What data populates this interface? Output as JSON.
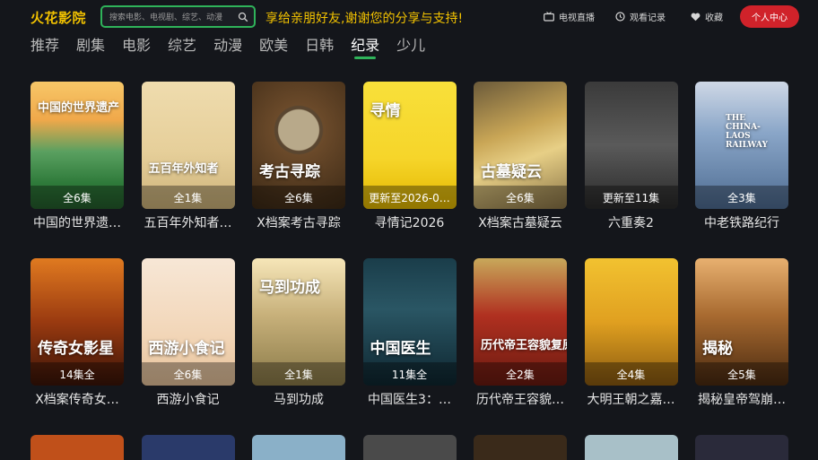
{
  "app": {
    "name": "火花影院"
  },
  "search": {
    "placeholder": "搜索电影、电视剧、综艺、动漫"
  },
  "marquee": "享给亲朋好友,谢谢您的分享与支持!",
  "header_buttons": {
    "tv": "电视直播",
    "history": "观看记录",
    "favorites": "收藏",
    "profile": "个人中心"
  },
  "tabs": [
    "推荐",
    "剧集",
    "电影",
    "综艺",
    "动漫",
    "欧美",
    "日韩",
    "纪录",
    "少儿"
  ],
  "active_tab": "纪录",
  "cards": [
    {
      "badge": "全6集",
      "title": "中国的世界遗…",
      "poster_text": "中国的世界遗产",
      "icon": "landscape-poster"
    },
    {
      "badge": "全1集",
      "title": "五百年外知者…",
      "poster_text": "五百年外知者",
      "icon": "village-poster"
    },
    {
      "badge": "全6集",
      "title": "X档案考古寻踪",
      "poster_text": "考古寻踪",
      "icon": "jade-disc-poster"
    },
    {
      "badge": "更新至2026-0…",
      "title": "寻情记2026",
      "poster_text": "寻情",
      "icon": "host-portrait-poster"
    },
    {
      "badge": "全6集",
      "title": "X档案古墓疑云",
      "poster_text": "古墓疑云",
      "icon": "gold-artifact-poster"
    },
    {
      "badge": "更新至11集",
      "title": "六重奏2",
      "poster_text": "",
      "icon": "group-portrait-poster"
    },
    {
      "badge": "全3集",
      "title": "中老铁路纪行",
      "poster_text": "THE CHINA-LAOS RAILWAY",
      "icon": "railway-poster"
    },
    {
      "badge": "14集全",
      "title": "X档案传奇女…",
      "poster_text": "传奇女影星",
      "icon": "silhouette-poster"
    },
    {
      "badge": "全6集",
      "title": "西游小食记",
      "poster_text": "西游小食记",
      "icon": "food-poster"
    },
    {
      "badge": "全1集",
      "title": "马到功成",
      "poster_text": "马到功成",
      "icon": "horse-poster"
    },
    {
      "badge": "11集全",
      "title": "中国医生3：…",
      "poster_text": "中国医生",
      "icon": "doctor-poster"
    },
    {
      "badge": "全2集",
      "title": "历代帝王容貌…",
      "poster_text": "历代帝王容貌复原",
      "icon": "emperor-poster"
    },
    {
      "badge": "全4集",
      "title": "大明王朝之嘉…",
      "poster_text": "",
      "icon": "ming-emperor-poster"
    },
    {
      "badge": "全5集",
      "title": "揭秘皇帝驾崩…",
      "poster_text": "揭秘",
      "icon": "ancient-emperor-poster"
    }
  ],
  "colors": {
    "accent_green": "#2fb35a",
    "brand_yellow": "#f2c200",
    "profile_red": "#d0222a",
    "background": "#14161b"
  }
}
